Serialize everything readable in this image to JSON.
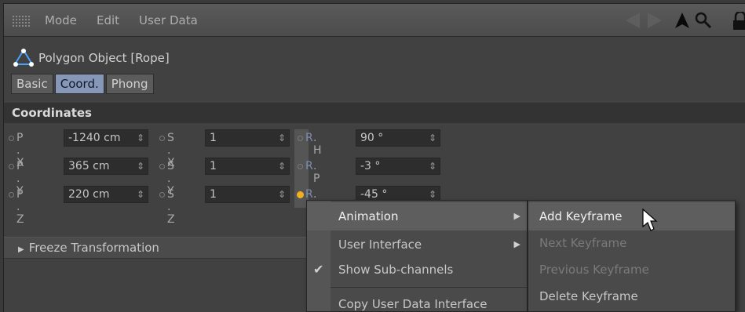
{
  "menubar": {
    "items": [
      "Mode",
      "Edit",
      "User Data"
    ],
    "icons": [
      "arrow-tool-icon",
      "search-icon",
      "lock-icon"
    ]
  },
  "object": {
    "title": "Polygon Object [Rope]",
    "icon": "polygon-object-icon"
  },
  "tabs": [
    {
      "label": "Basic",
      "active": false
    },
    {
      "label": "Coord.",
      "active": true
    },
    {
      "label": "Phong",
      "active": false
    }
  ],
  "section": {
    "title": "Coordinates"
  },
  "coords": {
    "rows": [
      {
        "p": {
          "label": "P . X",
          "value": "-1240 cm"
        },
        "s": {
          "label": "S . X",
          "value": "1"
        },
        "r": {
          "label": ". H",
          "value": "90 °"
        }
      },
      {
        "p": {
          "label": "P . Y",
          "value": "365 cm"
        },
        "s": {
          "label": "S . Y",
          "value": "1"
        },
        "r": {
          "label": ". P",
          "value": "-3 °"
        }
      },
      {
        "p": {
          "label": "P . Z",
          "value": "220 cm"
        },
        "s": {
          "label": "S . Z",
          "value": "1"
        },
        "r": {
          "label": ". B",
          "value": "-45 °"
        }
      }
    ],
    "r_prefix": "R",
    "spinner_glyph": "⇕",
    "keyframed_field": "R.B"
  },
  "freeze": {
    "label": "Freeze Transformation"
  },
  "context_menu": {
    "items": [
      {
        "label": "Animation",
        "submenu": true,
        "highlighted": true
      },
      {
        "label": "User Interface",
        "submenu": true
      },
      {
        "label": "Show Sub-channels",
        "checked": true
      },
      {
        "label": "Copy User Data Interface"
      }
    ],
    "submenu": [
      {
        "label": "Add Keyframe",
        "highlighted": true,
        "enabled": true
      },
      {
        "label": "Next Keyframe",
        "enabled": false
      },
      {
        "label": "Previous Keyframe",
        "enabled": false
      },
      {
        "label": "Delete Keyframe",
        "enabled": true
      }
    ]
  },
  "colors": {
    "accent_tab": "#8797b8",
    "keyframe_dot": "#f0b020",
    "panel_bg": "#414141"
  }
}
